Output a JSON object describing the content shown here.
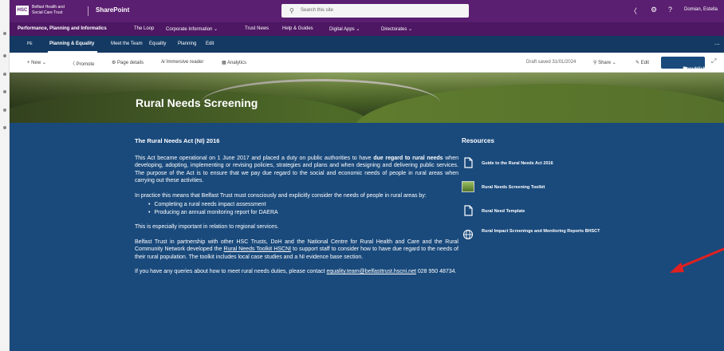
{
  "suite_bar": {
    "logo": "HSC",
    "org_line1": "Belfast Health and",
    "org_line2": "Social Care Trust",
    "app_name": "SharePoint",
    "search_placeholder": "Search this site",
    "user_name": "Domian, Estella",
    "icons": [
      "waffle-icon",
      "megaphone-icon",
      "settings-icon",
      "help-icon",
      "search-icon"
    ]
  },
  "hub_nav": [
    {
      "label": "Performance, Planning and Informatics"
    },
    {
      "label": "The Loop"
    },
    {
      "label": "Corporate Information"
    },
    {
      "label": "Trust News"
    },
    {
      "label": "Help & Guides"
    },
    {
      "label": "Digital Apps"
    },
    {
      "label": "Directorates"
    }
  ],
  "site_nav": {
    "site_initials": "PE",
    "items": [
      {
        "label": "Planning & Equality"
      },
      {
        "label": "Meet the Team"
      },
      {
        "label": "Equality"
      },
      {
        "label": "Planning"
      },
      {
        "label": "Edit"
      }
    ],
    "more": "..."
  },
  "command_bar": {
    "new": "New",
    "promote": "Promote",
    "page_details": "Page details",
    "immersive_reader": "Immersive reader",
    "analytics": "Analytics",
    "draft_status": "Draft saved 31/01/2024",
    "share": "Share",
    "edit": "Edit",
    "republish": "Republish"
  },
  "hero": {
    "title": "Rural Needs Screening"
  },
  "article": {
    "heading": "The Rural Needs Act (NI) 2016",
    "p1_a": "This Act became operational on 1 June 2017 and placed a duty on public authorities to have ",
    "p1_bold": "due regard to rural needs",
    "p1_b": " when developing, adopting, implementing or revising policies, strategies and plans and when designing and delivering public services.  The purpose of the Act is to ensure that we pay due regard to the social and economic needs of people in rural areas when carrying out these activities.",
    "p2": "In practice this means that Belfast Trust must consciously and explicitly consider the needs of people in rural areas by:",
    "bullets": [
      "Completing a rural needs impact assessment",
      "Producing an annual monitoring report for DAERA"
    ],
    "p3": "This is especially important in relation to regional services.",
    "p4_a": "Belfast Trust in partnership with other HSC Trusts, DoH and the National Centre for Rural Health and Care and the Rural Community Network developed the ",
    "p4_link": "Rural Needs Toolkit HSCNI",
    "p4_b": " to support staff to consider how to have due regard to the needs of their rural population. The toolkit includes local case studies and a NI evidence base section.",
    "p5_a": "If  you  have  any  queries  about  how  to  meet  rural  needs  duties,  please  contact ",
    "p5_link": "equality.team@belfasttrust.hscni.net",
    "p5_b": " 028 950 48734."
  },
  "resources": {
    "heading": "Resources",
    "items": [
      {
        "label": "Guide to the Rural Needs Act 2016",
        "icon": "document-icon"
      },
      {
        "label": "Rural Needs Screening Toolkit",
        "icon": "thumbnail-image"
      },
      {
        "label": "Rural Need Template",
        "icon": "document-icon"
      },
      {
        "label": "Rural Impact Screenings and Monitoring Reports BHSCT",
        "icon": "globe-icon"
      }
    ]
  },
  "colors": {
    "suite_bar": "#5b1f71",
    "hub_nav": "#4d1763",
    "site_nav": "#143a63",
    "content_bg": "#1a4a7c",
    "annotation_arrow": "#e02020"
  }
}
